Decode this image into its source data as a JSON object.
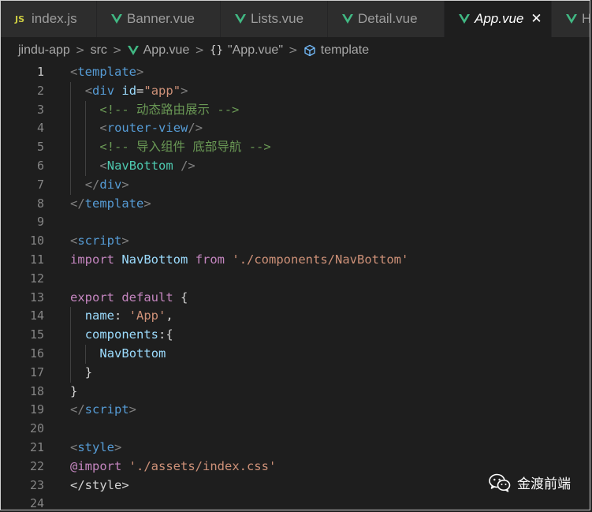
{
  "tabs": [
    {
      "label": "index.js",
      "icon": "js-icon",
      "active": false
    },
    {
      "label": "Banner.vue",
      "icon": "vue-icon",
      "active": false
    },
    {
      "label": "Lists.vue",
      "icon": "vue-icon",
      "active": false
    },
    {
      "label": "Detail.vue",
      "icon": "vue-icon",
      "active": false
    },
    {
      "label": "App.vue",
      "icon": "vue-icon",
      "active": true
    },
    {
      "label": "H",
      "icon": "vue-icon",
      "active": false
    }
  ],
  "breadcrumb": {
    "folder1": "jindu-app",
    "folder2": "src",
    "file": "App.vue",
    "section": "\"App.vue\"",
    "node": "template"
  },
  "colors": {
    "background": "#1e1e1e",
    "tag": "#569cd6",
    "string": "#ce9178",
    "comment": "#6a9955",
    "keyword": "#c586c0",
    "vue_green": "#41b883"
  },
  "code": {
    "current_line": 1,
    "lines": [
      {
        "n": "1",
        "indent": 0,
        "tokens": [
          [
            "t-tag",
            "<"
          ],
          [
            "t-name",
            "template"
          ],
          [
            "t-tag",
            ">"
          ]
        ]
      },
      {
        "n": "2",
        "indent": 1,
        "tokens": [
          [
            "t-tag",
            "<"
          ],
          [
            "t-name",
            "div"
          ],
          [
            "t-plain",
            " "
          ],
          [
            "t-attr",
            "id"
          ],
          [
            "t-plain",
            "="
          ],
          [
            "t-str",
            "\"app\""
          ],
          [
            "t-tag",
            ">"
          ]
        ]
      },
      {
        "n": "3",
        "indent": 2,
        "tokens": [
          [
            "t-com",
            "<!-- 动态路由展示 -->"
          ]
        ]
      },
      {
        "n": "4",
        "indent": 2,
        "tokens": [
          [
            "t-tag",
            "<"
          ],
          [
            "t-name",
            "router-view"
          ],
          [
            "t-tag",
            "/>"
          ]
        ]
      },
      {
        "n": "5",
        "indent": 2,
        "tokens": [
          [
            "t-com",
            "<!-- 导入组件 底部导航 -->"
          ]
        ]
      },
      {
        "n": "6",
        "indent": 2,
        "tokens": [
          [
            "t-tag",
            "<"
          ],
          [
            "t-comp",
            "NavBottom"
          ],
          [
            "t-plain",
            " "
          ],
          [
            "t-tag",
            "/>"
          ]
        ]
      },
      {
        "n": "7",
        "indent": 1,
        "tokens": [
          [
            "t-tag",
            "</"
          ],
          [
            "t-name",
            "div"
          ],
          [
            "t-tag",
            ">"
          ]
        ]
      },
      {
        "n": "8",
        "indent": 0,
        "tokens": [
          [
            "t-tag",
            "</"
          ],
          [
            "t-name",
            "template"
          ],
          [
            "t-tag",
            ">"
          ]
        ]
      },
      {
        "n": "9",
        "indent": 0,
        "tokens": []
      },
      {
        "n": "10",
        "indent": 0,
        "tokens": [
          [
            "t-tag",
            "<"
          ],
          [
            "t-name",
            "script"
          ],
          [
            "t-tag",
            ">"
          ]
        ]
      },
      {
        "n": "11",
        "indent": 0,
        "tokens": [
          [
            "t-kw",
            "import"
          ],
          [
            "t-plain",
            " "
          ],
          [
            "t-var",
            "NavBottom"
          ],
          [
            "t-plain",
            " "
          ],
          [
            "t-kw",
            "from"
          ],
          [
            "t-plain",
            " "
          ],
          [
            "t-str",
            "'./components/NavBottom'"
          ]
        ]
      },
      {
        "n": "12",
        "indent": 0,
        "tokens": []
      },
      {
        "n": "13",
        "indent": 0,
        "tokens": [
          [
            "t-kw",
            "export"
          ],
          [
            "t-plain",
            " "
          ],
          [
            "t-kw",
            "default"
          ],
          [
            "t-plain",
            " {"
          ]
        ]
      },
      {
        "n": "14",
        "indent": 1,
        "tokens": [
          [
            "t-var",
            "name"
          ],
          [
            "t-plain",
            ": "
          ],
          [
            "t-str",
            "'App'"
          ],
          [
            "t-plain",
            ","
          ]
        ]
      },
      {
        "n": "15",
        "indent": 1,
        "tokens": [
          [
            "t-var",
            "components"
          ],
          [
            "t-plain",
            ":{"
          ]
        ]
      },
      {
        "n": "16",
        "indent": 2,
        "tokens": [
          [
            "t-var",
            "NavBottom"
          ]
        ]
      },
      {
        "n": "17",
        "indent": 1,
        "tokens": [
          [
            "t-plain",
            "}"
          ]
        ]
      },
      {
        "n": "18",
        "indent": 0,
        "tokens": [
          [
            "t-plain",
            "}"
          ]
        ]
      },
      {
        "n": "19",
        "indent": 0,
        "tokens": [
          [
            "t-tag",
            "</"
          ],
          [
            "t-name",
            "script"
          ],
          [
            "t-tag",
            ">"
          ]
        ]
      },
      {
        "n": "20",
        "indent": 0,
        "tokens": []
      },
      {
        "n": "21",
        "indent": 0,
        "tokens": [
          [
            "t-tag",
            "<"
          ],
          [
            "t-name",
            "style"
          ],
          [
            "t-tag",
            ">"
          ]
        ]
      },
      {
        "n": "22",
        "indent": 0,
        "tokens": [
          [
            "t-kw",
            "@import"
          ],
          [
            "t-plain",
            " "
          ],
          [
            "t-str",
            "'./assets/index.css'"
          ]
        ]
      },
      {
        "n": "23",
        "indent": 0,
        "tokens": [
          [
            "t-plain",
            "</style>"
          ]
        ]
      },
      {
        "n": "24",
        "indent": 0,
        "tokens": []
      }
    ]
  },
  "watermark": {
    "text": "金渡前端",
    "icon": "wechat-icon"
  }
}
